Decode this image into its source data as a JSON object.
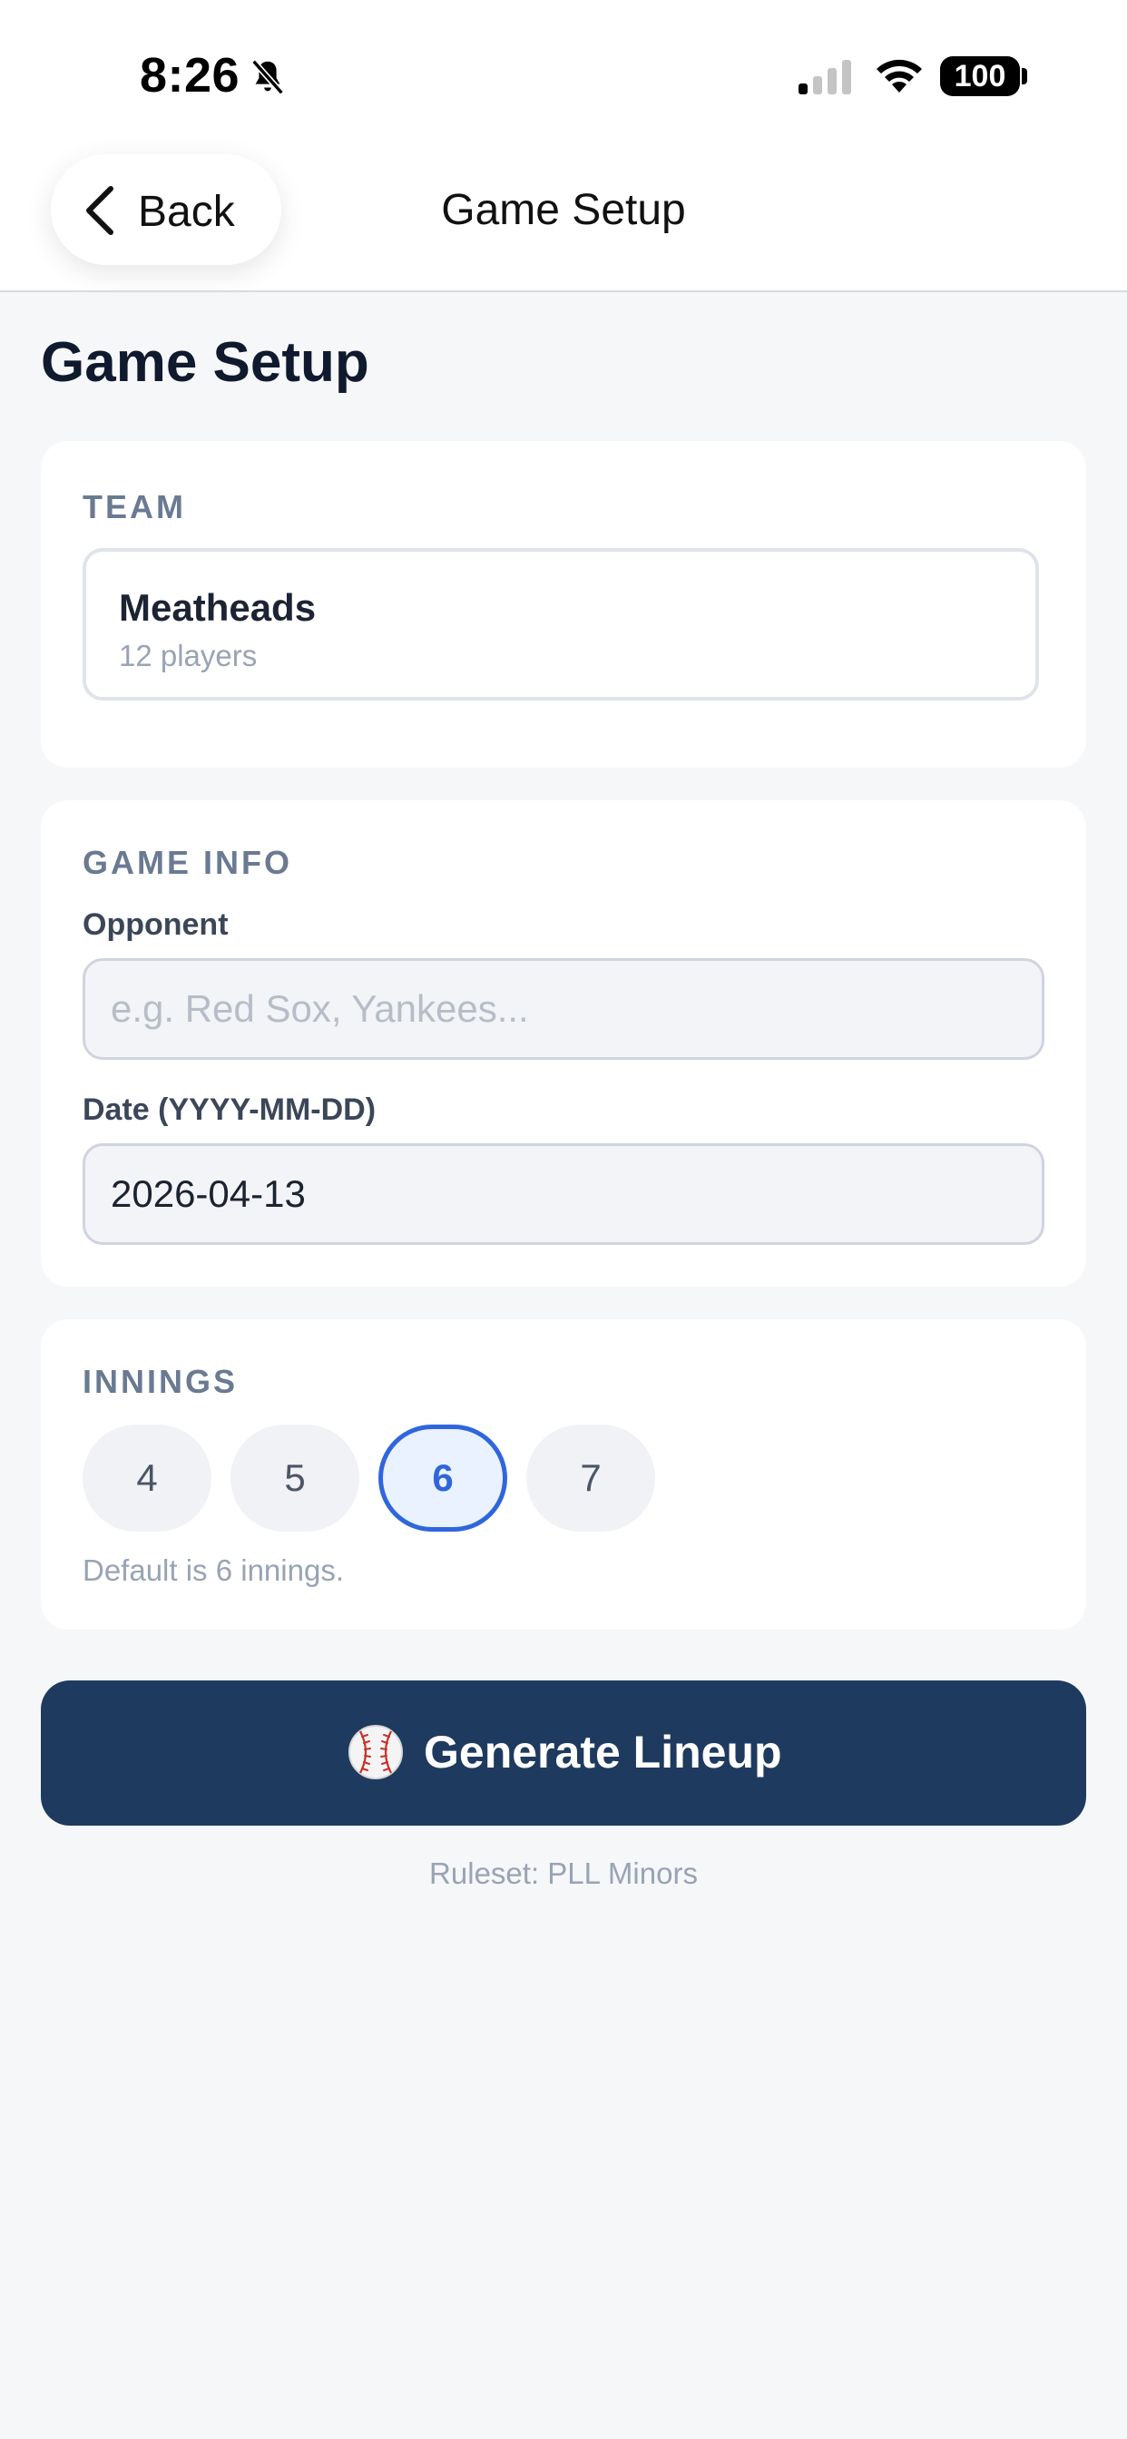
{
  "status_bar": {
    "time": "8:26",
    "battery": "100"
  },
  "nav": {
    "back_label": "Back",
    "title": "Game Setup"
  },
  "page": {
    "title": "Game Setup"
  },
  "team_section": {
    "label": "TEAM",
    "team_name": "Meatheads",
    "player_count": "12 players"
  },
  "game_info": {
    "label": "GAME INFO",
    "opponent_label": "Opponent",
    "opponent_value": "",
    "opponent_placeholder": "e.g. Red Sox, Yankees...",
    "date_label": "Date (YYYY-MM-DD)",
    "date_value": "2026-04-13"
  },
  "innings": {
    "label": "INNINGS",
    "options": [
      "4",
      "5",
      "6",
      "7"
    ],
    "selected": "6",
    "note": "Default is 6 innings."
  },
  "actions": {
    "generate_label": "Generate Lineup",
    "ruleset": "Ruleset: PLL Minors"
  },
  "colors": {
    "primary_button": "#1f3a5f",
    "accent": "#2f66dd",
    "background": "#f6f7f9"
  },
  "icons": [
    "bell-slash-icon",
    "cellular-signal-icon",
    "wifi-icon",
    "battery-icon",
    "chevron-left-icon",
    "baseball-icon"
  ]
}
